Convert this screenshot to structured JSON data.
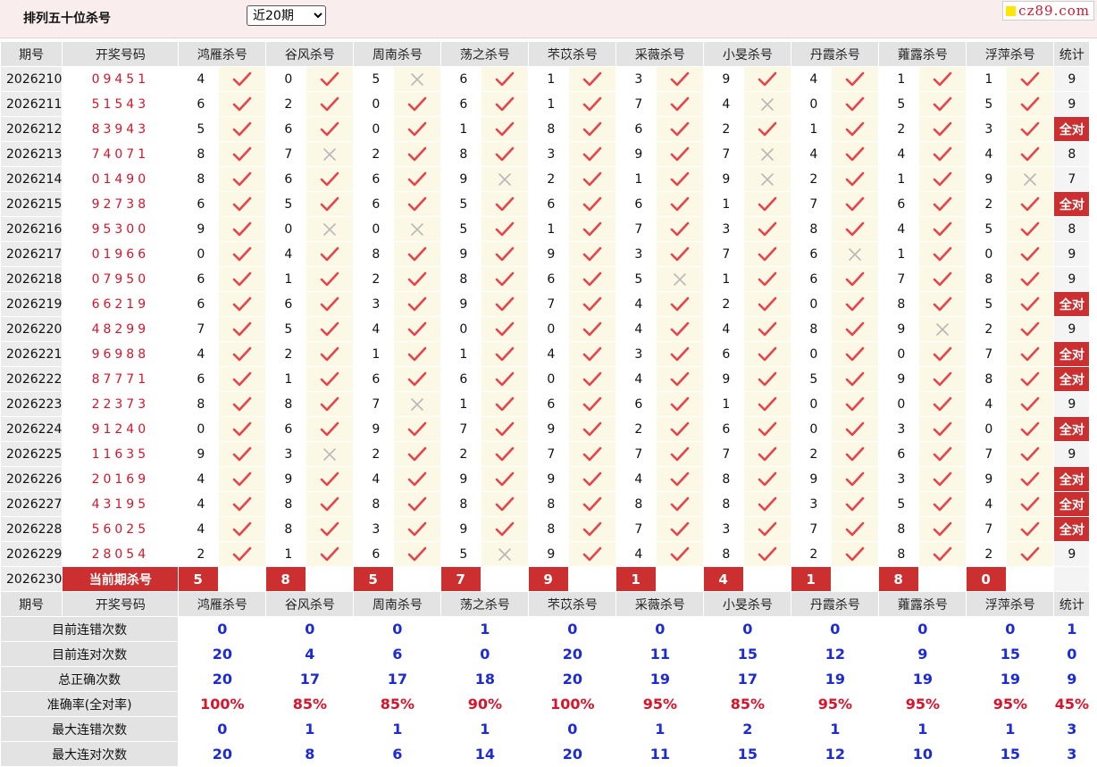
{
  "page": {
    "title": "排列五十位杀号",
    "select": {
      "value": "近20期",
      "options": [
        "近20期"
      ]
    },
    "logo": "cz89.com"
  },
  "table": {
    "headers": [
      "期号",
      "开奖号码",
      "鸿雁杀号",
      "谷风杀号",
      "周南杀号",
      "荡之杀号",
      "芣苡杀号",
      "采薇杀号",
      "小旻杀号",
      "丹霞杀号",
      "蕹露杀号",
      "浮萍杀号",
      "统计"
    ],
    "rows": [
      {
        "issue": "2026210",
        "draw": "09451",
        "kills": [
          4,
          0,
          5,
          6,
          1,
          3,
          9,
          4,
          1,
          1
        ],
        "hits": [
          1,
          1,
          0,
          1,
          1,
          1,
          1,
          1,
          1,
          1
        ],
        "total": "9"
      },
      {
        "issue": "2026211",
        "draw": "51543",
        "kills": [
          6,
          2,
          0,
          6,
          1,
          7,
          4,
          0,
          5,
          5
        ],
        "hits": [
          1,
          1,
          1,
          1,
          1,
          1,
          0,
          1,
          1,
          1
        ],
        "total": "9"
      },
      {
        "issue": "2026212",
        "draw": "83943",
        "kills": [
          5,
          6,
          0,
          1,
          8,
          6,
          2,
          1,
          2,
          3
        ],
        "hits": [
          1,
          1,
          1,
          1,
          1,
          1,
          1,
          1,
          1,
          1
        ],
        "total": "全对"
      },
      {
        "issue": "2026213",
        "draw": "74071",
        "kills": [
          8,
          7,
          2,
          8,
          3,
          9,
          7,
          4,
          4,
          4
        ],
        "hits": [
          1,
          0,
          1,
          1,
          1,
          1,
          0,
          1,
          1,
          1
        ],
        "total": "8"
      },
      {
        "issue": "2026214",
        "draw": "01490",
        "kills": [
          8,
          6,
          6,
          9,
          2,
          1,
          9,
          2,
          1,
          9
        ],
        "hits": [
          1,
          1,
          1,
          0,
          1,
          1,
          0,
          1,
          1,
          0
        ],
        "total": "7"
      },
      {
        "issue": "2026215",
        "draw": "92738",
        "kills": [
          6,
          5,
          6,
          5,
          6,
          6,
          1,
          7,
          6,
          2
        ],
        "hits": [
          1,
          1,
          1,
          1,
          1,
          1,
          1,
          1,
          1,
          1
        ],
        "total": "全对"
      },
      {
        "issue": "2026216",
        "draw": "95300",
        "kills": [
          9,
          0,
          0,
          5,
          1,
          7,
          3,
          8,
          4,
          5
        ],
        "hits": [
          1,
          0,
          0,
          1,
          1,
          1,
          1,
          1,
          1,
          1
        ],
        "total": "8"
      },
      {
        "issue": "2026217",
        "draw": "01966",
        "kills": [
          0,
          4,
          8,
          9,
          9,
          3,
          7,
          6,
          1,
          0
        ],
        "hits": [
          1,
          1,
          1,
          1,
          1,
          1,
          1,
          0,
          1,
          1
        ],
        "total": "9"
      },
      {
        "issue": "2026218",
        "draw": "07950",
        "kills": [
          6,
          1,
          2,
          8,
          6,
          5,
          1,
          6,
          7,
          8
        ],
        "hits": [
          1,
          1,
          1,
          1,
          1,
          0,
          1,
          1,
          1,
          1
        ],
        "total": "9"
      },
      {
        "issue": "2026219",
        "draw": "66219",
        "kills": [
          6,
          6,
          3,
          9,
          7,
          4,
          2,
          0,
          8,
          5
        ],
        "hits": [
          1,
          1,
          1,
          1,
          1,
          1,
          1,
          1,
          1,
          1
        ],
        "total": "全对"
      },
      {
        "issue": "2026220",
        "draw": "48299",
        "kills": [
          7,
          5,
          4,
          0,
          0,
          4,
          4,
          8,
          9,
          2
        ],
        "hits": [
          1,
          1,
          1,
          1,
          1,
          1,
          1,
          1,
          0,
          1
        ],
        "total": "9"
      },
      {
        "issue": "2026221",
        "draw": "96988",
        "kills": [
          4,
          2,
          1,
          1,
          4,
          3,
          6,
          0,
          0,
          7
        ],
        "hits": [
          1,
          1,
          1,
          1,
          1,
          1,
          1,
          1,
          1,
          1
        ],
        "total": "全对"
      },
      {
        "issue": "2026222",
        "draw": "87771",
        "kills": [
          6,
          1,
          6,
          6,
          0,
          4,
          9,
          5,
          9,
          8
        ],
        "hits": [
          1,
          1,
          1,
          1,
          1,
          1,
          1,
          1,
          1,
          1
        ],
        "total": "全对"
      },
      {
        "issue": "2026223",
        "draw": "22373",
        "kills": [
          8,
          8,
          7,
          1,
          6,
          6,
          1,
          0,
          0,
          4
        ],
        "hits": [
          1,
          1,
          0,
          1,
          1,
          1,
          1,
          1,
          1,
          1
        ],
        "total": "9"
      },
      {
        "issue": "2026224",
        "draw": "91240",
        "kills": [
          0,
          6,
          9,
          7,
          9,
          2,
          6,
          0,
          3,
          0
        ],
        "hits": [
          1,
          1,
          1,
          1,
          1,
          1,
          1,
          1,
          1,
          1
        ],
        "total": "全对"
      },
      {
        "issue": "2026225",
        "draw": "11635",
        "kills": [
          9,
          3,
          2,
          2,
          7,
          7,
          7,
          2,
          6,
          7
        ],
        "hits": [
          1,
          0,
          1,
          1,
          1,
          1,
          1,
          1,
          1,
          1
        ],
        "total": "9"
      },
      {
        "issue": "2026226",
        "draw": "20169",
        "kills": [
          4,
          9,
          4,
          9,
          9,
          4,
          8,
          9,
          3,
          9
        ],
        "hits": [
          1,
          1,
          1,
          1,
          1,
          1,
          1,
          1,
          1,
          1
        ],
        "total": "全对"
      },
      {
        "issue": "2026227",
        "draw": "43195",
        "kills": [
          4,
          8,
          8,
          8,
          8,
          8,
          8,
          3,
          5,
          4
        ],
        "hits": [
          1,
          1,
          1,
          1,
          1,
          1,
          1,
          1,
          1,
          1
        ],
        "total": "全对"
      },
      {
        "issue": "2026228",
        "draw": "56025",
        "kills": [
          4,
          8,
          3,
          9,
          8,
          7,
          3,
          7,
          8,
          7
        ],
        "hits": [
          1,
          1,
          1,
          1,
          1,
          1,
          1,
          1,
          1,
          1
        ],
        "total": "全对"
      },
      {
        "issue": "2026229",
        "draw": "28054",
        "kills": [
          2,
          1,
          6,
          5,
          9,
          4,
          8,
          2,
          8,
          2
        ],
        "hits": [
          1,
          1,
          1,
          0,
          1,
          1,
          1,
          1,
          1,
          1
        ],
        "total": "9"
      }
    ],
    "current": {
      "issue": "2026230",
      "label": "当前期杀号",
      "kills": [
        5,
        8,
        5,
        7,
        9,
        1,
        4,
        1,
        8,
        0
      ]
    },
    "stats": [
      {
        "label": "目前连错次数",
        "values": [
          "0",
          "0",
          "0",
          "1",
          "0",
          "0",
          "0",
          "0",
          "0",
          "0"
        ],
        "total": "1"
      },
      {
        "label": "目前连对次数",
        "values": [
          "20",
          "4",
          "6",
          "0",
          "20",
          "11",
          "15",
          "12",
          "9",
          "15"
        ],
        "total": "0"
      },
      {
        "label": "总正确次数",
        "values": [
          "20",
          "17",
          "17",
          "18",
          "20",
          "19",
          "17",
          "19",
          "19",
          "19"
        ],
        "total": "9"
      },
      {
        "label": "准确率(全对率)",
        "values": [
          "100%",
          "85%",
          "85%",
          "90%",
          "100%",
          "95%",
          "85%",
          "95%",
          "95%",
          "95%"
        ],
        "total": "45%",
        "pct": true
      },
      {
        "label": "最大连错次数",
        "values": [
          "0",
          "1",
          "1",
          "1",
          "0",
          "1",
          "2",
          "1",
          "1",
          "1"
        ],
        "total": "3"
      },
      {
        "label": "最大连对次数",
        "values": [
          "20",
          "8",
          "6",
          "14",
          "20",
          "11",
          "15",
          "12",
          "10",
          "15"
        ],
        "total": "3"
      }
    ]
  },
  "colors": {
    "accent": "#cc2f2f",
    "draw": "#d8132a",
    "stat": "#1d2ad8",
    "check": "#e8424a",
    "cross": "#b8b8b8"
  },
  "icons": {
    "hit": "check-icon",
    "miss": "cross-icon"
  }
}
